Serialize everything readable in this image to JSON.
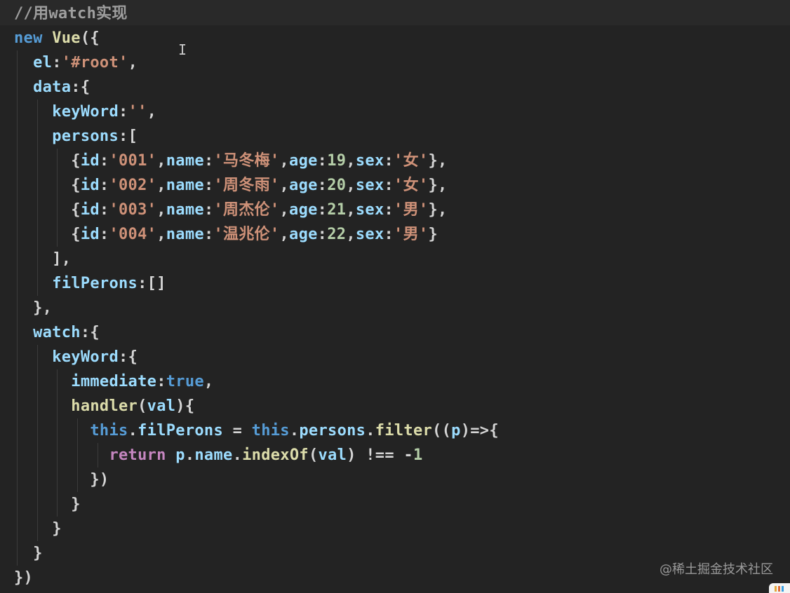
{
  "colors": {
    "background": "#232323",
    "comment": "#9e9e9e",
    "keyword": "#569cd6",
    "property": "#9cdcfe",
    "string": "#ce9178",
    "number": "#b5cea8",
    "punct": "#d4d4d4",
    "control": "#c586c0",
    "method": "#dcdcaa"
  },
  "code": [
    "//用watch实现",
    "new Vue({",
    "  el:'#root',",
    "  data:{",
    "    keyWord:'',",
    "    persons:[",
    "      {id:'001',name:'马冬梅',age:19,sex:'女'},",
    "      {id:'002',name:'周冬雨',age:20,sex:'女'},",
    "      {id:'003',name:'周杰伦',age:21,sex:'男'},",
    "      {id:'004',name:'温兆伦',age:22,sex:'男'}",
    "    ],",
    "    filPerons:[]",
    "  },",
    "  watch:{",
    "    keyWord:{",
    "      immediate:true,",
    "      handler(val){",
    "        this.filPerons = this.persons.filter((p)=>{",
    "          return p.name.indexOf(val) !== -1",
    "        })",
    "      }",
    "    }",
    "  }",
    "})"
  ],
  "cursor_glyph": "I",
  "watermark": "@稀土掘金技术社区"
}
